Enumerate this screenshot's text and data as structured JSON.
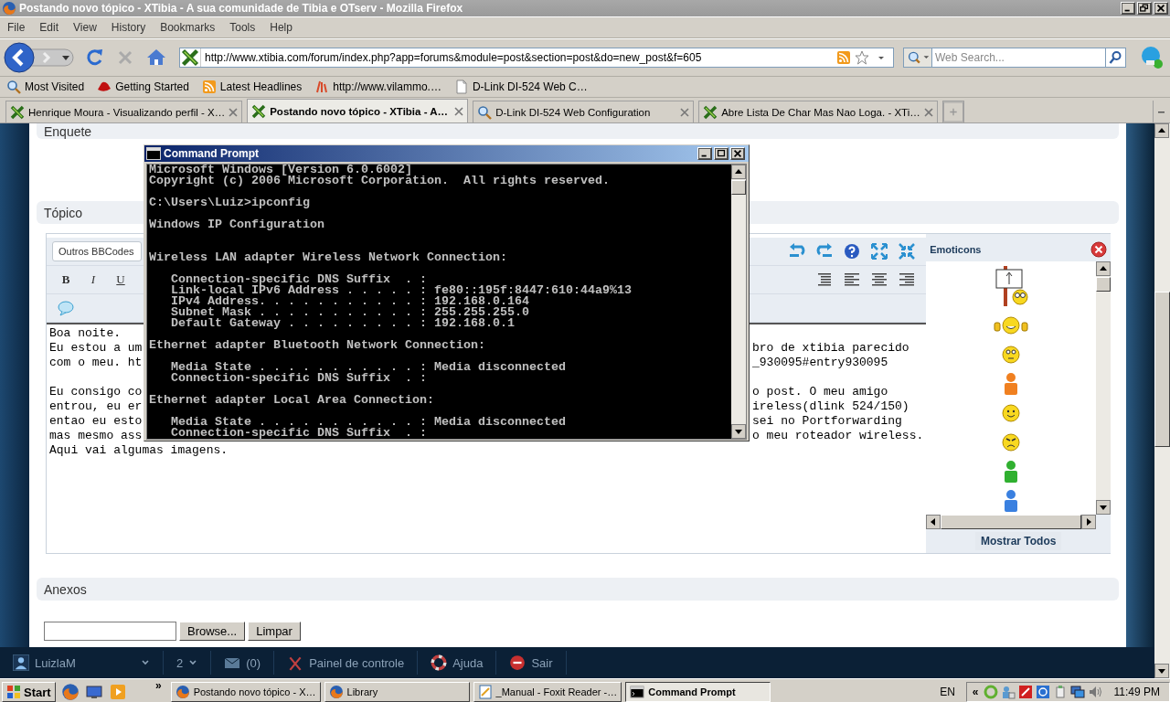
{
  "window": {
    "title": "Postando novo tópico - XTibia - A sua comunidade de Tibia e OTserv - Mozilla Firefox"
  },
  "menu": [
    "File",
    "Edit",
    "View",
    "History",
    "Bookmarks",
    "Tools",
    "Help"
  ],
  "toolbar": {
    "url": "http://www.xtibia.com/forum/index.php?app=forums&module=post&section=post&do=new_post&f=605",
    "search": {
      "placeholder": "Web Search..."
    }
  },
  "bookmarks": [
    {
      "label": "Most Visited",
      "kind": "search"
    },
    {
      "label": "Getting Started",
      "kind": "hat"
    },
    {
      "label": "Latest Headlines",
      "kind": "rss"
    },
    {
      "label": "http://www.vilammo.…",
      "kind": "site"
    },
    {
      "label": "D-Link DI-524 Web C…",
      "kind": "page"
    }
  ],
  "tabs": [
    {
      "label": "Henrique Moura - Visualizando perfil - X…",
      "selected": false,
      "kind": "xtibia"
    },
    {
      "label": "Postando novo tópico - XTibia - A…",
      "selected": true,
      "kind": "xtibia"
    },
    {
      "label": "D-Link DI-524 Web Configuration",
      "selected": false,
      "kind": "search"
    },
    {
      "label": "Abre Lista De Char Mas Nao Loga. - XTi…",
      "selected": false,
      "kind": "xtibia"
    }
  ],
  "page": {
    "poll_heading": "Enquete",
    "topic_heading": "Tópico",
    "editor": {
      "bbcode_select": "Outros BBCodes",
      "format_buttons": [
        {
          "label": "B",
          "kind": "bold"
        },
        {
          "label": "I",
          "kind": "italic"
        },
        {
          "label": "U",
          "kind": "underline"
        }
      ],
      "lines": [
        {
          "left": "Boa noite."
        },
        {
          "left": "Eu estou a um",
          "right": "bro de xtibia parecido"
        },
        {
          "left": "com o meu. ht",
          "right": "_930095#entry930095"
        },
        {
          "left": "Eu consigo co",
          "right": "o post. O meu amigo",
          "gap_before": true
        },
        {
          "left": "entrou, eu er",
          "right": "ireless(dlink 524/150)"
        },
        {
          "left": "entao eu esto",
          "right": "sei no Portforwarding"
        },
        {
          "left": "mas mesmo ass",
          "right": "o meu roteador wireless."
        },
        {
          "left": "Aqui vai algumas imagens."
        }
      ]
    },
    "emoticons": {
      "title": "Emoticons",
      "items": [
        {
          "kind": "sign"
        },
        {
          "kind": "thumbs"
        },
        {
          "kind": "rolleyes"
        },
        {
          "kind": "orange-user"
        },
        {
          "kind": "smile"
        },
        {
          "kind": "angry"
        },
        {
          "kind": "green-user"
        },
        {
          "kind": "blue-user"
        }
      ],
      "show_all": "Mostrar Todos"
    },
    "attachments": {
      "heading": "Anexos",
      "browse": "Browse...",
      "clear": "Limpar"
    },
    "user_bar": {
      "username": "LuizlaM",
      "count": "2",
      "messages": "(0)",
      "links": [
        {
          "label": "Painel de controle",
          "kind": "tools"
        },
        {
          "label": "Ajuda",
          "kind": "help"
        },
        {
          "label": "Sair",
          "kind": "exit"
        }
      ]
    }
  },
  "console": {
    "title": "Command Prompt",
    "output": "Microsoft Windows [Version 6.0.6002]\nCopyright (c) 2006 Microsoft Corporation.  All rights reserved.\n\nC:\\Users\\Luiz>ipconfig\n\nWindows IP Configuration\n\n\nWireless LAN adapter Wireless Network Connection:\n\n   Connection-specific DNS Suffix  . :\n   Link-local IPv6 Address . . . . . : fe80::195f:8447:610:44a9%13\n   IPv4 Address. . . . . . . . . . . : 192.168.0.164\n   Subnet Mask . . . . . . . . . . . : 255.255.255.0\n   Default Gateway . . . . . . . . . : 192.168.0.1\n\nEthernet adapter Bluetooth Network Connection:\n\n   Media State . . . . . . . . . . . : Media disconnected\n   Connection-specific DNS Suffix  . :\n\nEthernet adapter Local Area Connection:\n\n   Media State . . . . . . . . . . . : Media disconnected\n   Connection-specific DNS Suffix  . :"
  },
  "taskbar": {
    "start": "Start",
    "chevron": "»",
    "buttons": [
      {
        "label": "Postando novo tópico - X…",
        "kind": "firefox",
        "selected": false
      },
      {
        "label": "Library",
        "kind": "firefox",
        "selected": false
      },
      {
        "label": "_Manual - Foxit Reader -…",
        "kind": "reader",
        "selected": false
      },
      {
        "label": "Command Prompt",
        "kind": "console",
        "selected": true
      }
    ],
    "language": "EN",
    "tray_chevron": "«",
    "clock": "11:49 PM"
  }
}
